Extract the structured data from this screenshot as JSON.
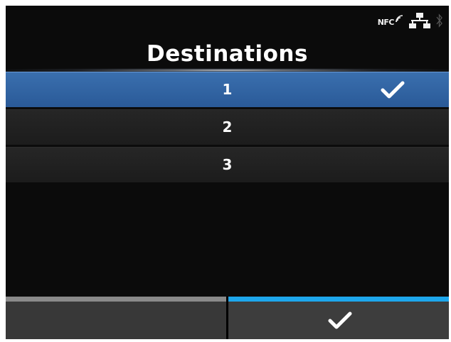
{
  "status": {
    "nfc_label": "NFC",
    "icons": [
      "nfc-icon",
      "network-icon",
      "bluetooth-icon"
    ]
  },
  "header": {
    "title": "Destinations"
  },
  "list": {
    "items": [
      {
        "label": "1",
        "selected": true,
        "checked": true
      },
      {
        "label": "2",
        "selected": false,
        "checked": false
      },
      {
        "label": "3",
        "selected": false,
        "checked": false
      }
    ]
  },
  "footer": {
    "left_button": {
      "icon": null,
      "accent_color": "#8a8a8a"
    },
    "right_button": {
      "icon": "checkmark-icon",
      "accent_color": "#1ea7ec"
    }
  },
  "colors": {
    "background": "#0b0b0b",
    "selected_row": "#3265a3",
    "accent_blue": "#1ea7ec"
  }
}
